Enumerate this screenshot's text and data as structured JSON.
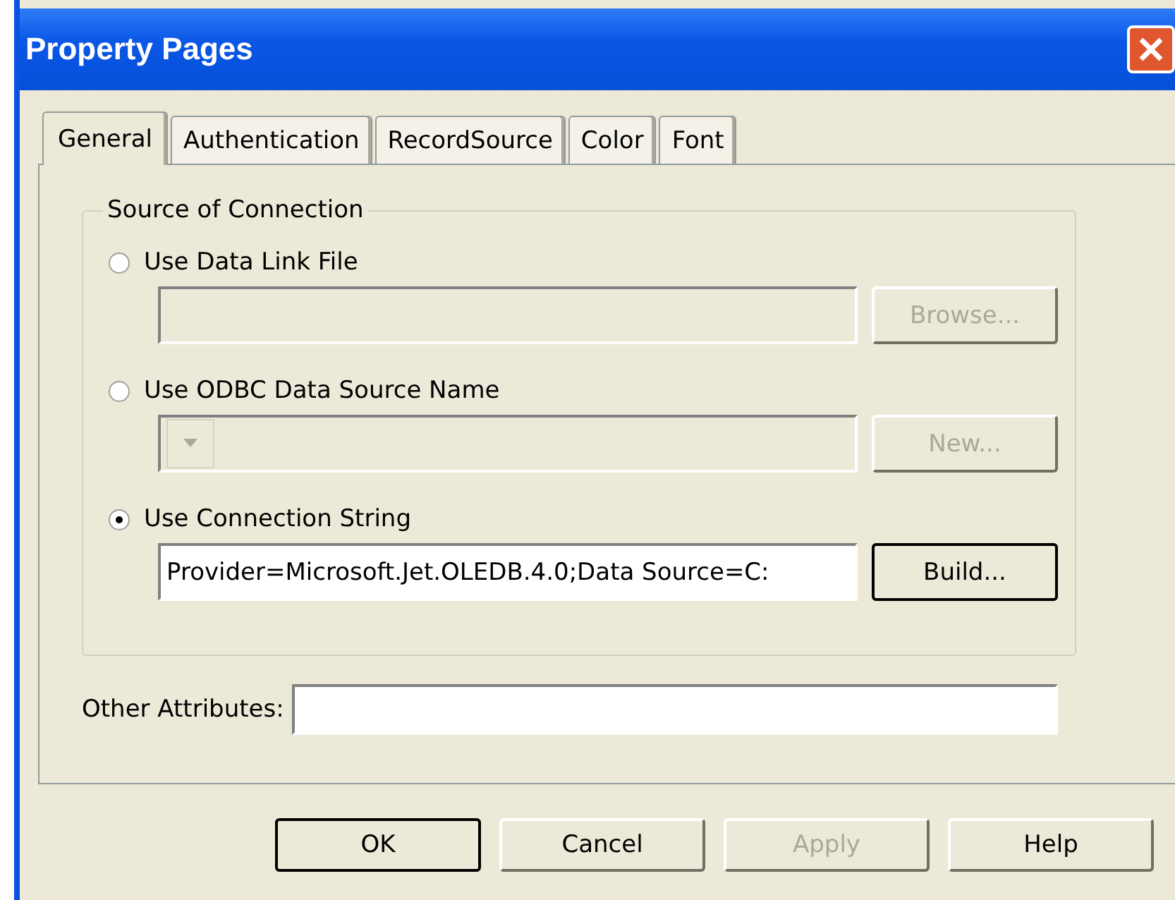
{
  "window": {
    "title": "Property Pages"
  },
  "tabs": [
    {
      "label": "General",
      "selected": true
    },
    {
      "label": "Authentication",
      "selected": false
    },
    {
      "label": "RecordSource",
      "selected": false
    },
    {
      "label": "Color",
      "selected": false
    },
    {
      "label": "Font",
      "selected": false
    }
  ],
  "group": {
    "title": "Source of Connection"
  },
  "options": [
    {
      "label": "Use Data Link File",
      "selected": false,
      "kind": "text",
      "disabled": true,
      "button": {
        "label": "Browse...",
        "disabled": true
      }
    },
    {
      "label": "Use ODBC Data Source Name",
      "selected": false,
      "kind": "combo",
      "disabled": true,
      "button": {
        "label": "New...",
        "disabled": true
      }
    },
    {
      "label": "Use Connection String",
      "selected": true,
      "kind": "text",
      "value": "Provider=Microsoft.Jet.OLEDB.4.0;Data Source=C:",
      "disabled": false,
      "button": {
        "label": "Build...",
        "disabled": false
      }
    }
  ],
  "other_attributes": {
    "label": "Other Attributes:"
  },
  "buttons": [
    {
      "label": "OK",
      "disabled": false,
      "default": true
    },
    {
      "label": "Cancel",
      "disabled": false,
      "default": false
    },
    {
      "label": "Apply",
      "disabled": true,
      "default": false
    },
    {
      "label": "Help",
      "disabled": false,
      "default": false
    }
  ]
}
